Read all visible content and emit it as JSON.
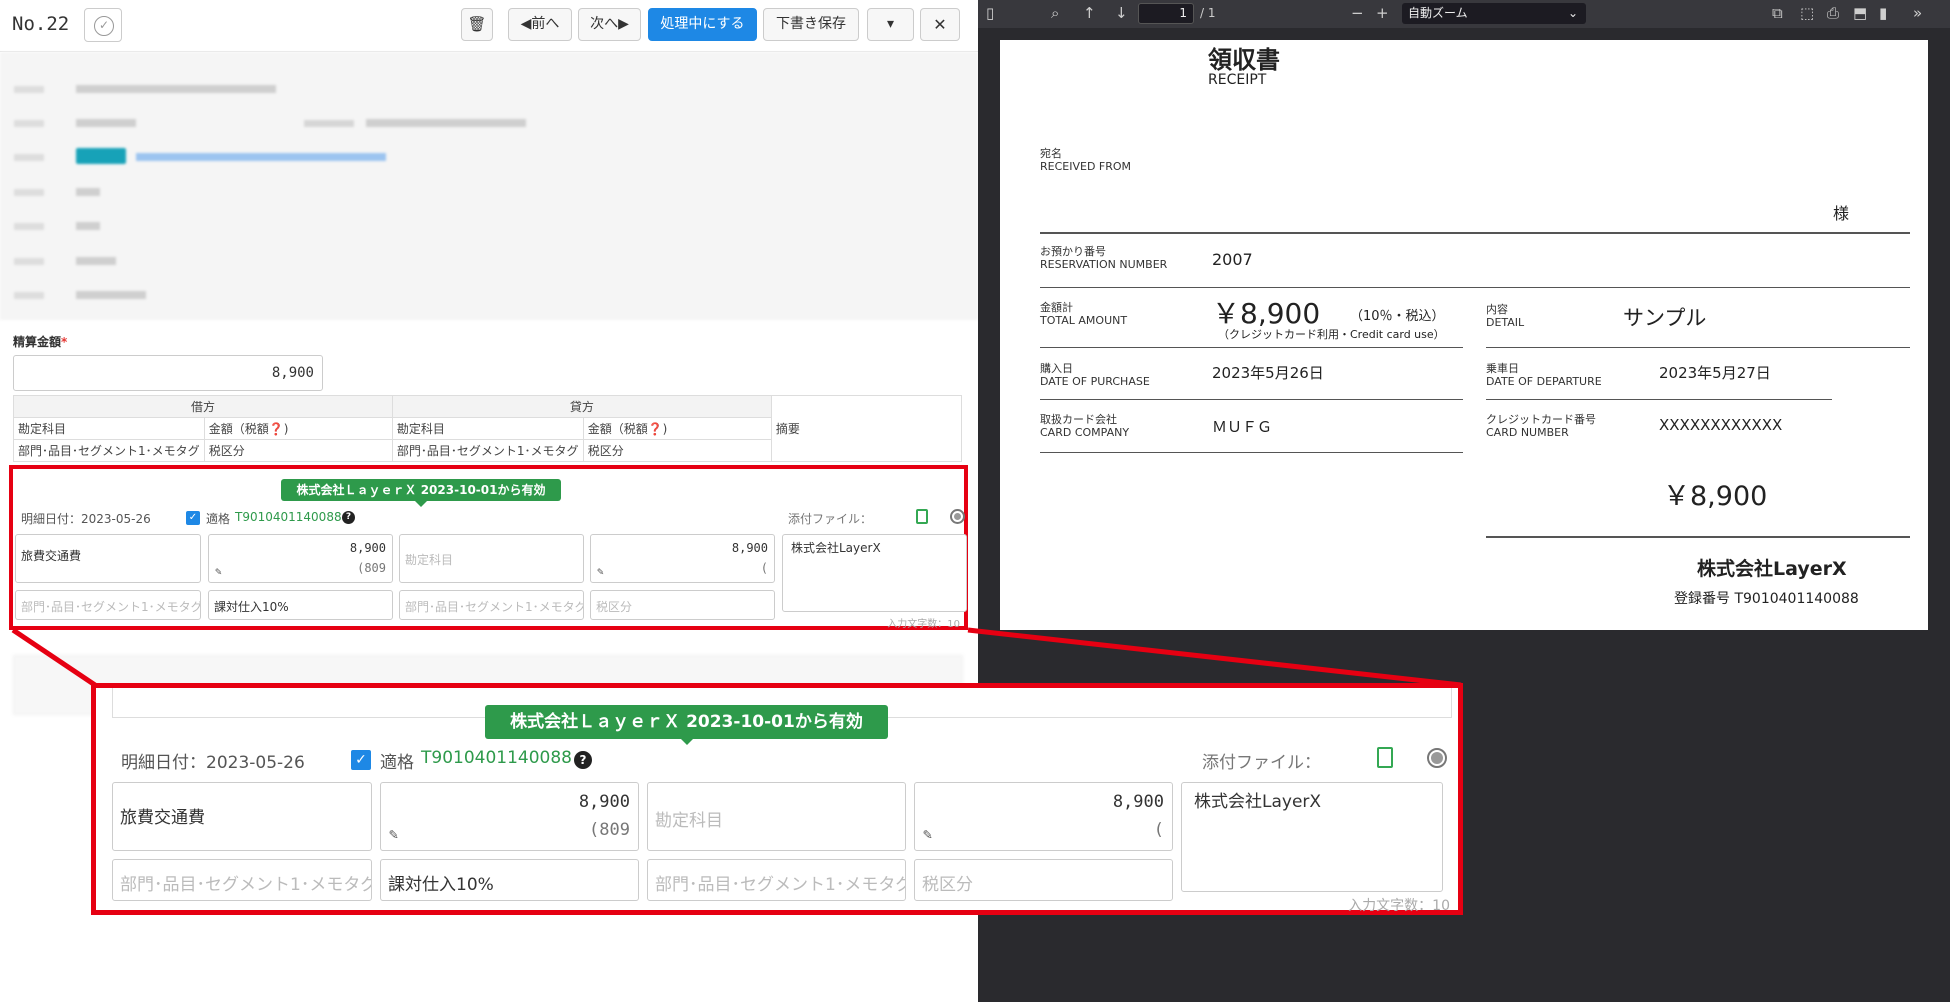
{
  "toolbar": {
    "doc_no": "No.22",
    "check": "✓",
    "trash": "🗑",
    "prev": "◀前へ",
    "next": "次へ▶",
    "processing": "処理中にする",
    "save_draft": "下書き保存",
    "dropdown": "▾",
    "close": "✕"
  },
  "form": {
    "amount_label": "精算金額",
    "required_mark": "*",
    "amount_value": "8,900",
    "table": {
      "debit": "借方",
      "credit": "貸方",
      "account": "勘定科目",
      "amount_tax": "金額（税額❓)",
      "memo": "摘要",
      "dept": "部門･品目･セグメント1･メモタグ",
      "tax_class": "税区分"
    }
  },
  "detail": {
    "tag": "株式会社ＬａｙｅｒＸ 2023-10-01から有効",
    "date_label": "明細日付：2023-05-26",
    "qualified_label": "適格",
    "reg_no": "T9010401140088",
    "attach_label": "添付ファイル：",
    "account_value": "旅費交通費",
    "debit_amount": "8,900",
    "debit_tax": "(809",
    "credit_account_placeholder": "勘定科目",
    "credit_amount": "8,900",
    "credit_tax": "(",
    "memo_value": "株式会社LayerX",
    "dept_placeholder": "部門･品目･セグメント1･メモタグ",
    "tax_class_value": "課対仕入10%",
    "credit_dept_placeholder": "部門･品目･セグメント1･メモタグ",
    "credit_tax_placeholder": "税区分",
    "char_count": "入力文字数：10"
  },
  "pdf": {
    "page_current": "1",
    "page_total": "/ 1",
    "zoom": "自動ズーム",
    "receipt": {
      "title": "領収書",
      "title_en": "RECEIPT",
      "to_ja": "宛名",
      "to_en": "RECEIVED FROM",
      "sama": "様",
      "resv_ja": "お預かり番号",
      "resv_en": "RESERVATION NUMBER",
      "resv_value": "2007",
      "total_ja": "金額計",
      "total_en": "TOTAL AMOUNT",
      "total_value": "￥8,900",
      "total_tax": "（10％・税込）",
      "total_note": "（クレジットカード利用・Credit card use）",
      "detail_ja": "内容",
      "detail_en": "DETAIL",
      "detail_value": "サンプル",
      "purchase_ja": "購入日",
      "purchase_en": "DATE OF PURCHASE",
      "purchase_value": "2023年5月26日",
      "depart_ja": "乗車日",
      "depart_en": "DATE OF DEPARTURE",
      "depart_value": "2023年5月27日",
      "card_co_ja": "取扱カード会社",
      "card_co_en": "CARD COMPANY",
      "card_co_value": "ＭＵＦＧ",
      "card_no_ja": "クレジットカード番号",
      "card_no_en": "CARD NUMBER",
      "card_no_value": "XXXXXXXXXXXX",
      "big_amount": "￥8,900",
      "company": "株式会社LayerX",
      "reg_label": "登録番号 T9010401140088"
    }
  }
}
